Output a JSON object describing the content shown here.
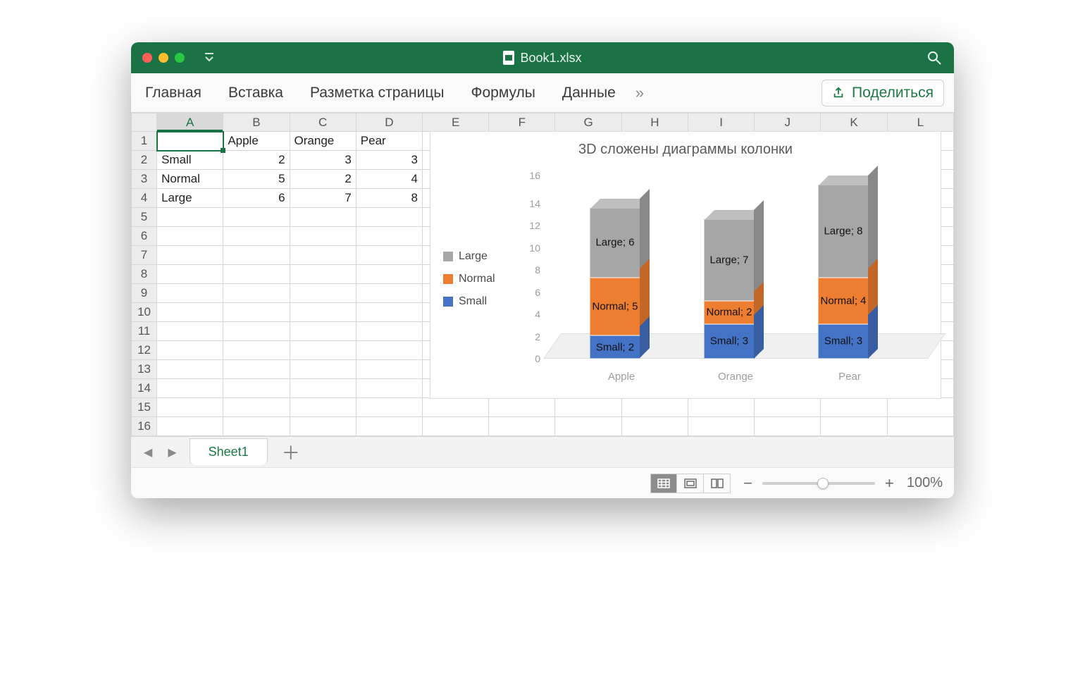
{
  "title": "Book1.xlsx",
  "ribbon": {
    "tabs": [
      "Главная",
      "Вставка",
      "Разметка страницы",
      "Формулы",
      "Данные"
    ],
    "more_indicator": "»",
    "share_label": "Поделиться"
  },
  "columns": [
    "A",
    "B",
    "C",
    "D",
    "E",
    "F",
    "G",
    "H",
    "I",
    "J",
    "K",
    "L"
  ],
  "row_count": 16,
  "selected_cell": "A1",
  "cells": {
    "B1": "Apple",
    "C1": "Orange",
    "D1": "Pear",
    "A2": "Small",
    "B2": "2",
    "C2": "3",
    "D2": "3",
    "A3": "Normal",
    "B3": "5",
    "C3": "2",
    "D3": "4",
    "A4": "Large",
    "B4": "6",
    "C4": "7",
    "D4": "8"
  },
  "chart_data": {
    "type": "bar",
    "stacked": true,
    "style": "3d",
    "title": "3D сложены диаграммы колонки",
    "categories": [
      "Apple",
      "Orange",
      "Pear"
    ],
    "series": [
      {
        "name": "Small",
        "values": [
          2,
          3,
          3
        ],
        "color": "#4472c4"
      },
      {
        "name": "Normal",
        "values": [
          5,
          2,
          4
        ],
        "color": "#ed7d31"
      },
      {
        "name": "Large",
        "values": [
          6,
          7,
          8
        ],
        "color": "#a6a6a6"
      }
    ],
    "legend_order": [
      "Large",
      "Normal",
      "Small"
    ],
    "ylim": [
      0,
      16
    ],
    "ytick_step": 2,
    "data_labels": [
      [
        "Small; 2",
        "Small; 3",
        "Small; 3"
      ],
      [
        "Normal; 5",
        "Normal; 2",
        "Normal; 4"
      ],
      [
        "Large; 6",
        "Large; 7",
        "Large; 8"
      ]
    ]
  },
  "sheet_tabs": {
    "active": "Sheet1"
  },
  "status": {
    "zoom_label": "100%"
  }
}
